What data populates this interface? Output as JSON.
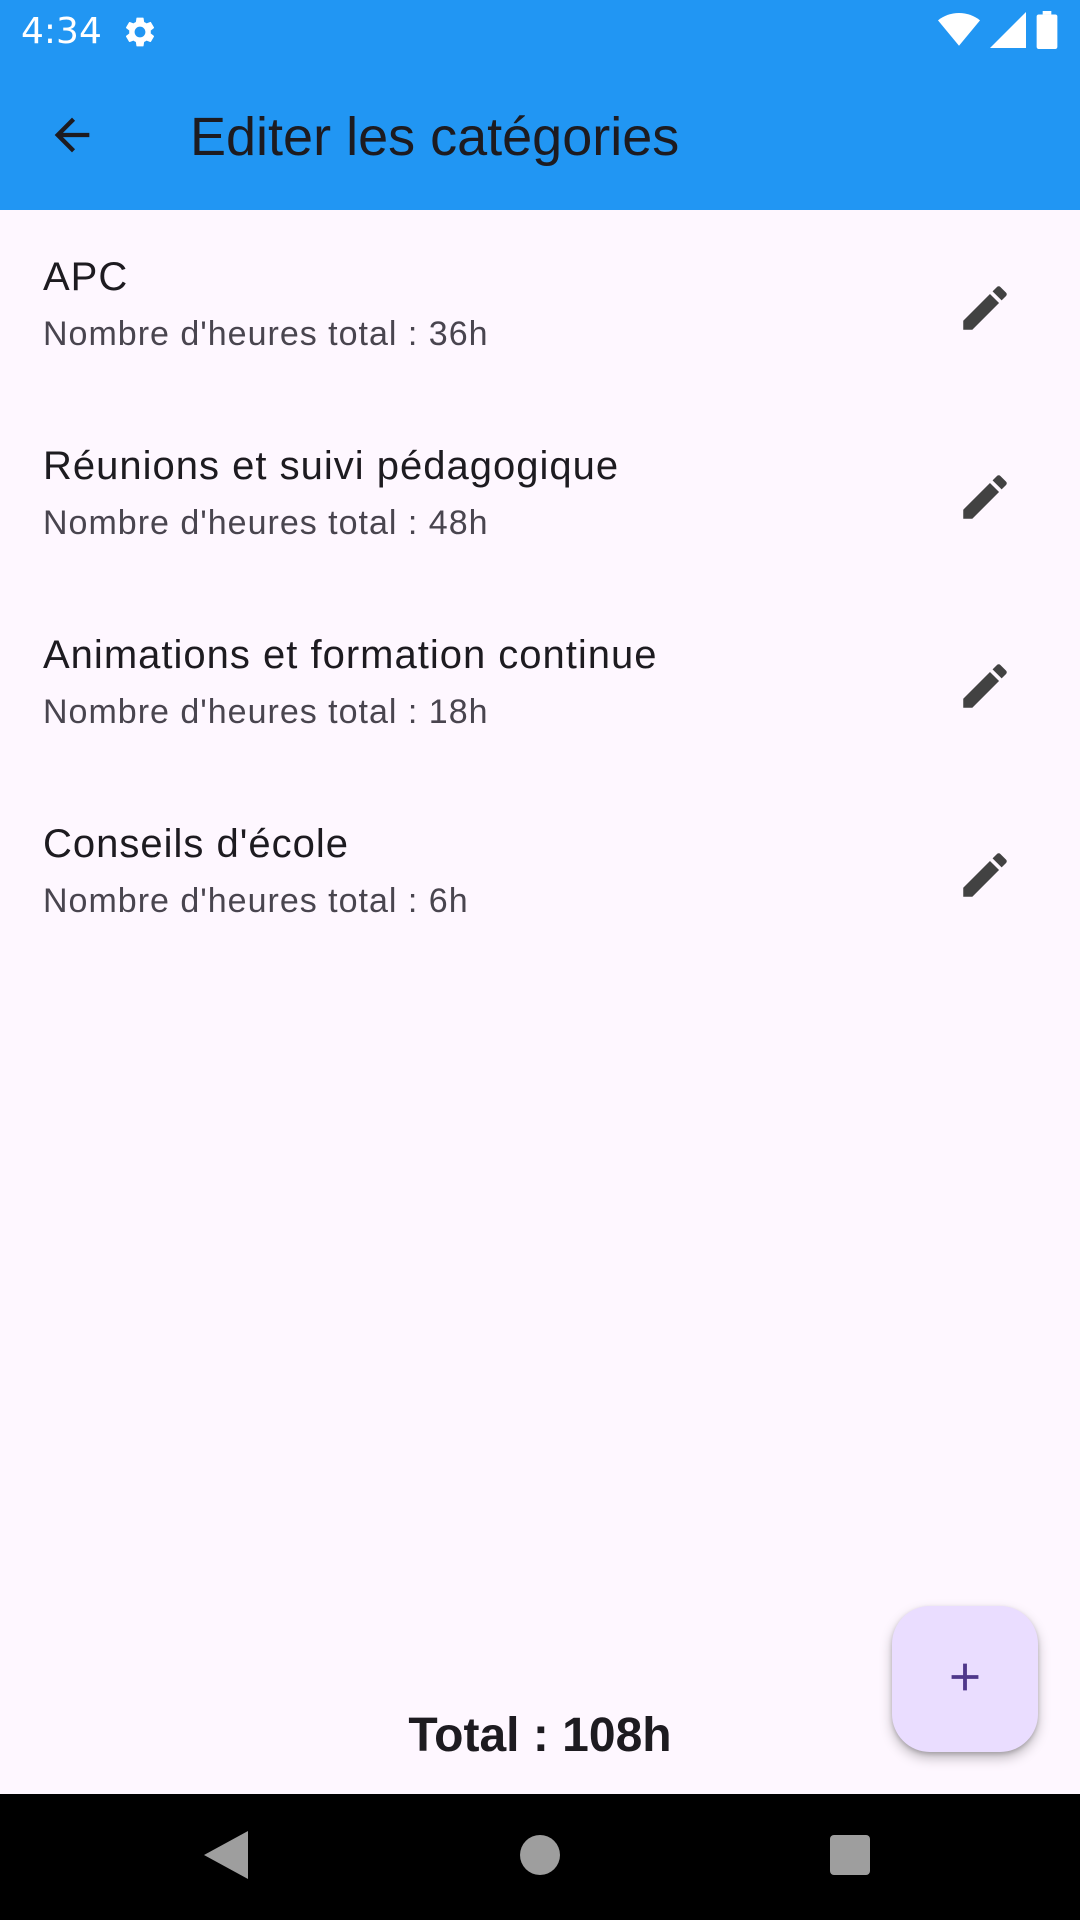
{
  "status_bar": {
    "time": "4:34",
    "icons": [
      "settings-icon",
      "wifi-icon",
      "signal-icon",
      "battery-icon"
    ],
    "background": "#2196F3"
  },
  "app_bar": {
    "title": "Editer les catégories",
    "back_icon": "arrow-back-icon"
  },
  "categories": [
    {
      "name": "APC",
      "hours": "Nombre d'heures total : 36h"
    },
    {
      "name": "Réunions et suivi pédagogique",
      "hours": "Nombre d'heures total : 48h"
    },
    {
      "name": "Animations et formation continue",
      "hours": "Nombre d'heures total : 18h"
    },
    {
      "name": "Conseils d'école",
      "hours": "Nombre d'heures total : 6h"
    }
  ],
  "total": "Total : 108h",
  "fab": {
    "icon": "add-icon",
    "background": "#EADDFF",
    "icon_color": "#4F378B"
  },
  "nav_bar": {
    "buttons": [
      "nav-back-icon",
      "nav-home-icon",
      "nav-recents-icon"
    ]
  },
  "colors": {
    "background": "#FEF7FF",
    "primary_text": "#1D1B20",
    "secondary_text": "#49454F",
    "edit_icon": "#424242"
  }
}
